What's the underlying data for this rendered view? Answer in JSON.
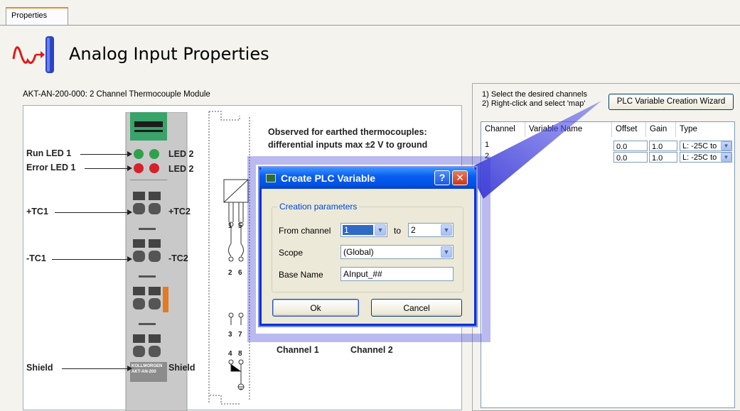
{
  "tab": {
    "label": "Properties"
  },
  "header": {
    "title": "Analog Input Properties"
  },
  "module": {
    "caption": "AKT-AN-200-000: 2 Channel Thermocouple Module",
    "note_line1": "Observed for earthed thermocouples:",
    "note_line2": "differential inputs max ±2 V to ground",
    "left_labels": {
      "run_led": "Run LED 1",
      "error_led": "Error LED 1",
      "tc1_plus": "+TC1",
      "tc1_minus": "-TC1",
      "shield": "Shield"
    },
    "right_labels": {
      "led2_a": "LED 2",
      "led2_b": "LED 2",
      "tc2_plus": "+TC2",
      "tc2_minus": "-TC2",
      "shield": "Shield"
    },
    "terminal_numbers": [
      "1",
      "5",
      "2",
      "6",
      "3",
      "7",
      "4",
      "8"
    ],
    "channel1": "Channel 1",
    "channel2": "Channel 2",
    "device_text_1": "KOLLMORGEN",
    "device_text_2": "AKT-AN-200"
  },
  "instructions": {
    "line1": "1) Select the desired channels",
    "line2": "2) Right-click and select 'map'"
  },
  "wizard_button": "PLC Variable Creation Wizard",
  "grid": {
    "headers": [
      "Channel",
      "Variable Name",
      "Offset",
      "Gain",
      "Type"
    ],
    "rows": [
      {
        "channel": "1",
        "variable": "",
        "offset": "0.0",
        "gain": "1.0",
        "type": "L: -25C to"
      },
      {
        "channel": "2",
        "variable": "",
        "offset": "0.0",
        "gain": "1.0",
        "type": "L: -25C to"
      }
    ]
  },
  "dialog": {
    "title": "Create PLC Variable",
    "help_glyph": "?",
    "close_glyph": "✕",
    "group_label": "Creation parameters",
    "from_label": "From channel",
    "from_value": "1",
    "to_label": "to",
    "to_value": "2",
    "scope_label": "Scope",
    "scope_value": "(Global)",
    "base_label": "Base Name",
    "base_value": "AInput_##",
    "ok": "Ok",
    "cancel": "Cancel"
  },
  "colors": {
    "dialog_title": "#0a5ef0",
    "selected_row": "#316ac5",
    "module_green": "#3aa36a",
    "led_red": "#d4222a",
    "led_green": "#2ea14b",
    "callout": "#3a3ad8"
  },
  "icons": [
    "analog-signal-icon",
    "app-icon",
    "help-icon",
    "close-icon",
    "chevron-down-icon",
    "ground-icon"
  ]
}
